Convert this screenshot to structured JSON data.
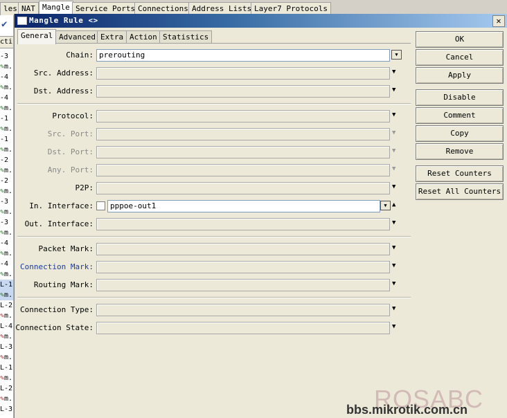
{
  "background": {
    "tabs": [
      {
        "label": "les",
        "active": false
      },
      {
        "label": "NAT",
        "active": false
      },
      {
        "label": "Mangle",
        "active": true
      },
      {
        "label": "Service Ports",
        "active": false
      },
      {
        "label": "Connections",
        "active": false
      },
      {
        "label": "Address Lists",
        "active": false
      },
      {
        "label": "Layer7 Protocols",
        "active": false
      }
    ],
    "list_header": "cti",
    "list_rows": [
      "-3",
      "m.",
      "-4",
      "m.",
      "-4",
      "m.",
      "-1",
      "m.",
      "-1",
      "m.",
      "-2",
      "m.",
      "-2",
      "m.",
      "-3",
      "m.",
      "-3",
      "m.",
      "-4",
      "m.",
      "-4",
      "m.",
      "L-1",
      "m.",
      "L-2",
      "m.",
      "L-4",
      "m.",
      "L-3",
      "m.",
      "L-1",
      "m.",
      "L-2",
      "m.",
      "L-3"
    ]
  },
  "dialog": {
    "title": "Mangle Rule <>",
    "tabs": [
      "General",
      "Advanced",
      "Extra",
      "Action",
      "Statistics"
    ],
    "active_tab": "General",
    "fields": {
      "chain": {
        "label": "Chain:",
        "value": "prerouting"
      },
      "src_address": {
        "label": "Src. Address:"
      },
      "dst_address": {
        "label": "Dst. Address:"
      },
      "protocol": {
        "label": "Protocol:"
      },
      "src_port": {
        "label": "Src. Port:"
      },
      "dst_port": {
        "label": "Dst. Port:"
      },
      "any_port": {
        "label": "Any. Port:"
      },
      "p2p": {
        "label": "P2P:"
      },
      "in_interface": {
        "label": "In. Interface:",
        "value": "pppoe-out1"
      },
      "out_interface": {
        "label": "Out. Interface:"
      },
      "packet_mark": {
        "label": "Packet Mark:"
      },
      "connection_mark": {
        "label": "Connection Mark:"
      },
      "routing_mark": {
        "label": "Routing Mark:"
      },
      "connection_type": {
        "label": "Connection Type:"
      },
      "connection_state": {
        "label": "Connection State:"
      }
    },
    "buttons": {
      "ok": "OK",
      "cancel": "Cancel",
      "apply": "Apply",
      "disable": "Disable",
      "comment": "Comment",
      "copy": "Copy",
      "remove": "Remove",
      "reset_counters": "Reset Counters",
      "reset_all_counters": "Reset All Counters"
    }
  },
  "watermark": {
    "brand": "ROSABC",
    "url": "bbs.mikrotik.com.cn"
  },
  "colors": {
    "title_gradient_start": "#0a246a",
    "title_gradient_end": "#a6caf0",
    "highlight_label": "#1a3aa0"
  }
}
